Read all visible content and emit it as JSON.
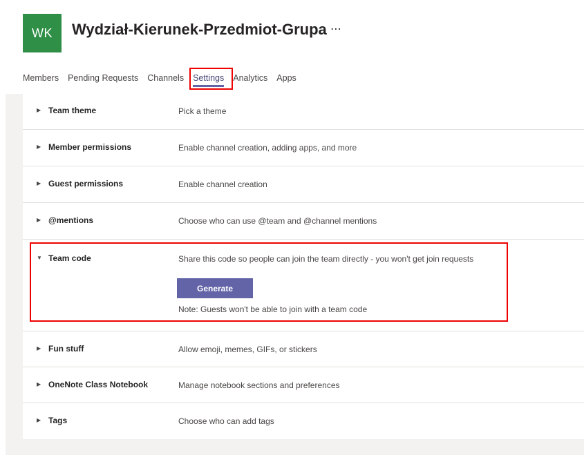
{
  "team": {
    "initials": "WK",
    "name": "Wydział-Kierunek-Przedmiot-Grupa",
    "more_icon": "⋯",
    "avatar_color": "#2f8f46"
  },
  "tabs": [
    {
      "label": "Members",
      "active": false
    },
    {
      "label": "Pending Requests",
      "active": false
    },
    {
      "label": "Channels",
      "active": false
    },
    {
      "label": "Settings",
      "active": true
    },
    {
      "label": "Analytics",
      "active": false
    },
    {
      "label": "Apps",
      "active": false
    }
  ],
  "settings": [
    {
      "name": "Team theme",
      "description": "Pick a theme",
      "expanded": false
    },
    {
      "name": "Member permissions",
      "description": "Enable channel creation, adding apps, and more",
      "expanded": false
    },
    {
      "name": "Guest permissions",
      "description": "Enable channel creation",
      "expanded": false
    },
    {
      "name": "@mentions",
      "description": "Choose who can use @team and @channel mentions",
      "expanded": false
    },
    {
      "name": "Team code",
      "description": "Share this code so people can join the team directly - you won't get join requests",
      "expanded": true,
      "button_label": "Generate",
      "note": "Note: Guests won't be able to join with a team code"
    },
    {
      "name": "Fun stuff",
      "description": "Allow emoji, memes, GIFs, or stickers",
      "expanded": false
    },
    {
      "name": "OneNote Class Notebook",
      "description": "Manage notebook sections and preferences",
      "expanded": false
    },
    {
      "name": "Tags",
      "description": "Choose who can add tags",
      "expanded": false
    }
  ],
  "colors": {
    "accent": "#6264a7",
    "highlight": "#ee0000"
  }
}
